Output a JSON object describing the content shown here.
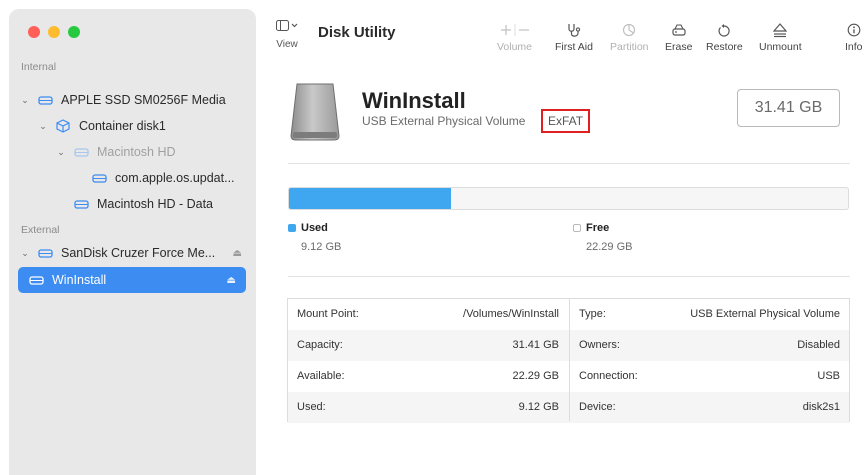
{
  "window": {
    "title": "Disk Utility",
    "traffic_lights": {
      "close": "#ff5f57",
      "minimize": "#febc2e",
      "zoom": "#28c840"
    }
  },
  "toolbar": {
    "view_label": "View",
    "buttons": [
      {
        "label": "Volume",
        "icon": "plus-minus-icon",
        "enabled": false
      },
      {
        "label": "First Aid",
        "icon": "stethoscope-icon",
        "enabled": true
      },
      {
        "label": "Partition",
        "icon": "pie-icon",
        "enabled": false
      },
      {
        "label": "Erase",
        "icon": "erase-icon",
        "enabled": true
      },
      {
        "label": "Restore",
        "icon": "restore-icon",
        "enabled": true
      },
      {
        "label": "Unmount",
        "icon": "eject-icon",
        "enabled": true
      },
      {
        "label": "Info",
        "icon": "info-icon",
        "enabled": true
      }
    ]
  },
  "sidebar": {
    "internal_label": "Internal",
    "external_label": "External",
    "internal_items": [
      {
        "label": "APPLE SSD SM0256F Media"
      },
      {
        "label": "Container disk1"
      },
      {
        "label": "Macintosh HD"
      },
      {
        "label": "com.apple.os.updat..."
      },
      {
        "label": "Macintosh HD - Data"
      }
    ],
    "external_items": [
      {
        "label": "SanDisk Cruzer Force Me..."
      },
      {
        "label": "WinInstall"
      }
    ]
  },
  "volume": {
    "name": "WinInstall",
    "subtitle": "USB External Physical Volume",
    "filesystem": "ExFAT",
    "size": "31.41 GB"
  },
  "usage": {
    "used_fraction": 0.29,
    "used_label": "Used",
    "used_value": "9.12 GB",
    "free_label": "Free",
    "free_value": "22.29 GB",
    "used_color": "#3fa7ef",
    "free_color": "#ffffff"
  },
  "info": {
    "left": [
      {
        "key": "Mount Point:",
        "value": "/Volumes/WinInstall"
      },
      {
        "key": "Capacity:",
        "value": "31.41 GB"
      },
      {
        "key": "Available:",
        "value": "22.29 GB"
      },
      {
        "key": "Used:",
        "value": "9.12 GB"
      }
    ],
    "right": [
      {
        "key": "Type:",
        "value": "USB External Physical Volume"
      },
      {
        "key": "Owners:",
        "value": "Disabled"
      },
      {
        "key": "Connection:",
        "value": "USB"
      },
      {
        "key": "Device:",
        "value": "disk2s1"
      }
    ]
  },
  "colors": {
    "accent": "#3c8cf1",
    "highlight_border": "#e02020"
  }
}
